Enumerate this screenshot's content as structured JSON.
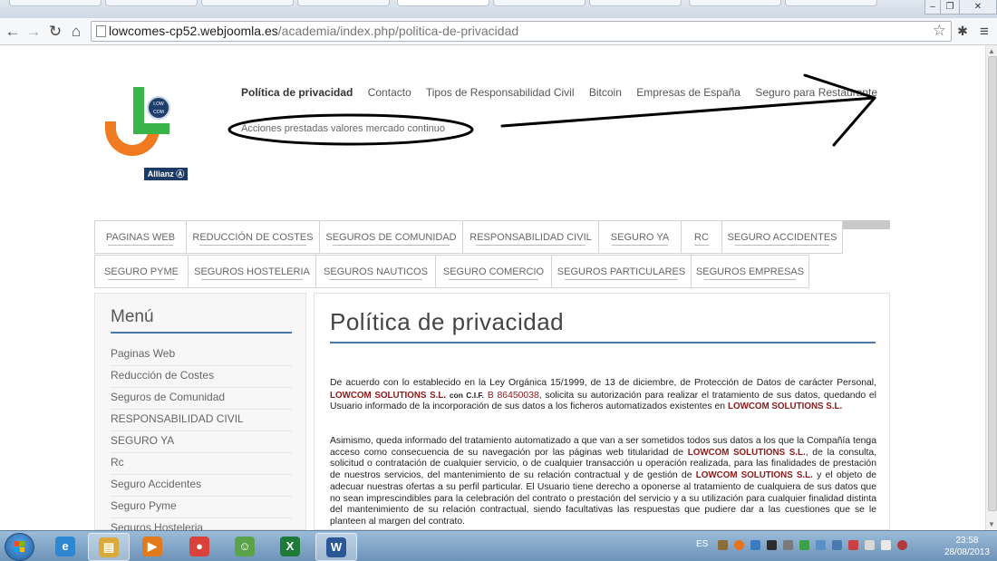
{
  "browser": {
    "url_host": "lowcomes-cp52.webjoomla.es",
    "url_path": "/academia/index.php/politica-de-privacidad"
  },
  "logo": {
    "badge_top": "LOW",
    "badge_bottom": "COM",
    "allianz": "Allianz Ⓐ"
  },
  "topnav": {
    "items": [
      "Política de privacidad",
      "Contacto",
      "Tipos de Responsabilidad Civil",
      "Bitcoin",
      "Empresas de España",
      "Seguro para Restaurante"
    ],
    "sub_item": "Acciones prestadas valores mercado continuo"
  },
  "mainmenu": {
    "row1": [
      "PAGINAS WEB",
      "REDUCCIÓN DE COSTES",
      "SEGUROS DE COMUNIDAD",
      "RESPONSABILIDAD CIVIL",
      "SEGURO YA",
      "RC",
      "SEGURO ACCIDENTES"
    ],
    "row2": [
      "SEGURO PYME",
      "SEGUROS HOSTELERIA",
      "SEGUROS NAUTICOS",
      "SEGURO COMERCIO",
      "SEGUROS PARTICULARES",
      "SEGUROS EMPRESAS"
    ]
  },
  "sidebar": {
    "title": "Menú",
    "items": [
      "Paginas Web",
      "Reducción de Costes",
      "Seguros de Comunidad",
      "RESPONSABILIDAD CIVIL",
      "SEGURO YA",
      "Rc",
      "Seguro Accidentes",
      "Seguro Pyme",
      "Seguros Hosteleria"
    ]
  },
  "content": {
    "title": "Política de privacidad",
    "brand": "LOWCOM SOLUTIONS S.L.",
    "brand_cif": "LOWCOM SOLUTIONS S.L.",
    "cif_label": "con C.I.F.",
    "cif_value": "B 86450038",
    "p1_a": "De acuerdo con lo establecido en la Ley Orgánica 15/1999, de 13 de diciembre, de Protección de Datos de carácter Personal,",
    "p1_b": ", solicita su autorización para realizar el tratamiento de sus datos, quedando el Usuario informado de la incorporación de sus datos a los ficheros automatizados existentes en",
    "p2_a": "Asimismo, queda informado del tratamiento automatizado a que van a ser sometidos todos sus datos a los que la Compañía tenga acceso como consecuencia de su navegación por las páginas web titularidad de",
    "p2_b": ", de la consulta, solicitud o contratación de cualquier servicio, o de cualquier transacción u operación realizada, para las finalidades de prestación de nuestros servicios, del mantenimiento de su relación contractual y de gestión de",
    "p2_c": "y el objeto de adecuar nuestras ofertas a su perfil particular. El Usuario tiene derecho a oponerse al tratamiento de cualquiera de sus datos que no sean imprescindibles para la celebración del contrato o prestación del servicio y a su utilización para cualquier finalidad distinta del mantenimiento de su relación contractual, siendo facultativas las respuestas que pudiere dar a las cuestiones que se le planteen al margen del contrato."
  },
  "taskbar": {
    "lang": "ES",
    "time": "23:58",
    "date": "28/08/2013",
    "apps": [
      {
        "icon": "internet-explorer-icon",
        "glyph": "e",
        "color": "#2f86d1"
      },
      {
        "icon": "file-explorer-icon",
        "glyph": "▤",
        "color": "#d9a93a"
      },
      {
        "icon": "media-player-icon",
        "glyph": "▶",
        "color": "#e07a1d"
      },
      {
        "icon": "chrome-icon",
        "glyph": "●",
        "color": "#d9413a"
      },
      {
        "icon": "messenger-icon",
        "glyph": "☺",
        "color": "#5aa34a"
      },
      {
        "icon": "excel-icon",
        "glyph": "X",
        "color": "#1f7a3a"
      },
      {
        "icon": "word-icon",
        "glyph": "W",
        "color": "#2b5797"
      }
    ]
  }
}
